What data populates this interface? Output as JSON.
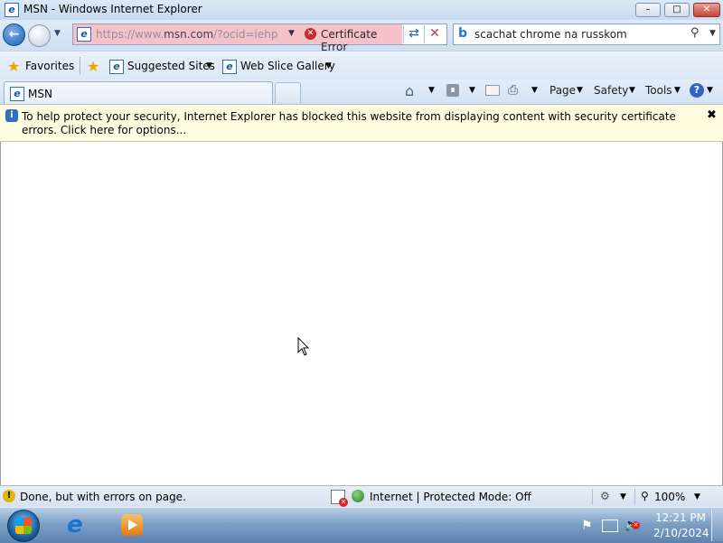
{
  "window": {
    "title": "MSN - Windows Internet Explorer",
    "minimize": "–",
    "maximize": "□",
    "close": "✕"
  },
  "nav": {
    "address_prefix": "https://www.",
    "address_domain": "msn.com",
    "address_suffix": "/?ocid=iehp",
    "certificate_error": "Certificate Error",
    "search_value": "scachat chrome na russkom"
  },
  "favorites_bar": {
    "favorites": "Favorites",
    "suggested_sites": "Suggested Sites",
    "web_slice_gallery": "Web Slice Gallery"
  },
  "tabs": [
    {
      "label": "MSN"
    }
  ],
  "command_bar": {
    "page": "Page",
    "safety": "Safety",
    "tools": "Tools"
  },
  "info_bar": {
    "message": "To help protect your security, Internet Explorer has blocked this website from displaying content with security certificate errors. Click here for options..."
  },
  "status_bar": {
    "status": "Done, but with errors on page.",
    "zone": "Internet | Protected Mode: Off",
    "zoom": "100%"
  },
  "taskbar": {
    "time": "12:21 PM",
    "date": "2/10/2024"
  },
  "icons": {
    "back": "back-arrow-icon",
    "forward": "forward-arrow-icon",
    "ie": "ie-logo-icon",
    "certificate": "certificate-error-icon",
    "refresh": "refresh-icon",
    "stop": "stop-icon",
    "bing": "bing-icon",
    "search": "magnifier-icon",
    "home": "home-icon",
    "feeds": "rss-feed-icon",
    "mail": "mail-icon",
    "print": "printer-icon",
    "help": "help-icon",
    "info": "shield-info-icon",
    "warning": "warning-icon",
    "globe": "globe-icon",
    "zoom": "zoom-icon"
  }
}
